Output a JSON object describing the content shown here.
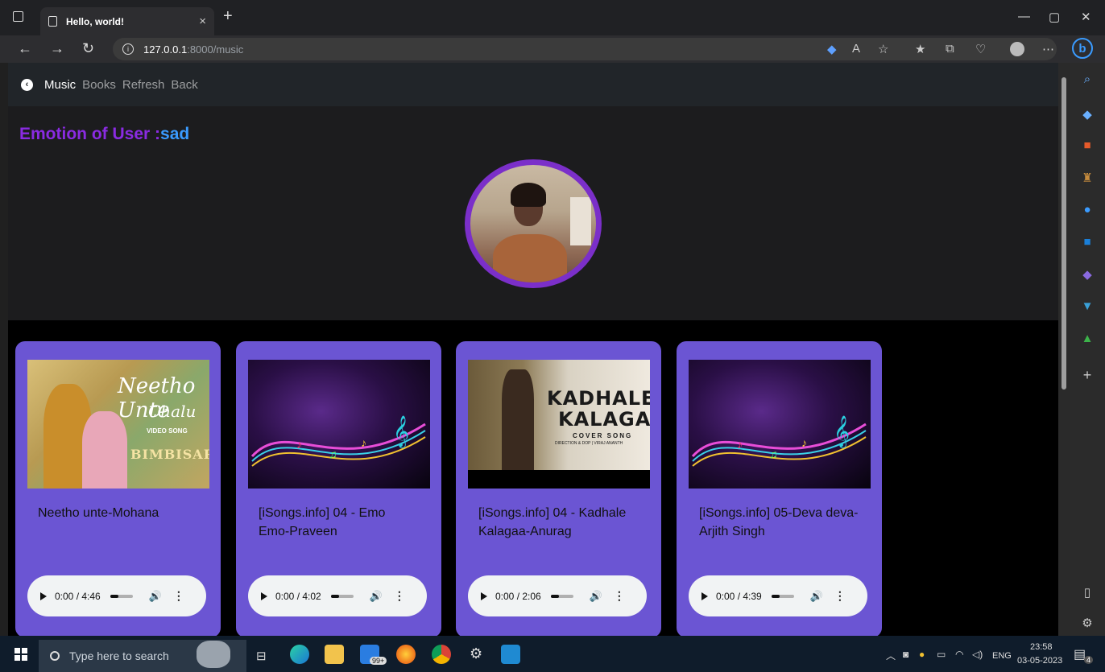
{
  "browser": {
    "tab_title": "Hello, world!",
    "url_host": "127.0.0.1",
    "url_path": ":8000/music"
  },
  "nav": {
    "links": [
      "Music",
      "Books",
      "Refresh",
      "Back"
    ]
  },
  "emotion": {
    "label": "Emotion of User :",
    "value": "sad"
  },
  "cards": [
    {
      "title": "Neetho unte-Mohana",
      "time": "0:00 / 4:46"
    },
    {
      "title": "[iSongs.info] 04 - Emo Emo-Praveen",
      "time": "0:00 / 4:02"
    },
    {
      "title": "[iSongs.info] 04 - Kadhale Kalagaa-Anurag",
      "time": "0:00 / 2:06"
    },
    {
      "title": "[iSongs.info] 05-Deva deva-Arjith Singh",
      "time": "0:00 / 4:39"
    }
  ],
  "covers": {
    "neetho": {
      "line1": "Neetho Unte",
      "line2": "Chalu",
      "line3": "VIDEO SONG",
      "line4": "BIMBISARA"
    },
    "kadhale": {
      "line1": "KADHALE",
      "line2": "KALAGA",
      "line3": "COVER SONG",
      "line4": "DIRECTION & DOP | VIRAJ ANANTH"
    }
  },
  "taskbar": {
    "search_placeholder": "Type here to search",
    "time": "23:58",
    "date": "03-05-2023",
    "lang": "ENG",
    "store_badge": "99+",
    "notif_count": "4"
  },
  "colors": {
    "card": "#6b55d3",
    "emotion_label": "#8a2be2",
    "emotion_value": "#3a9bff"
  }
}
